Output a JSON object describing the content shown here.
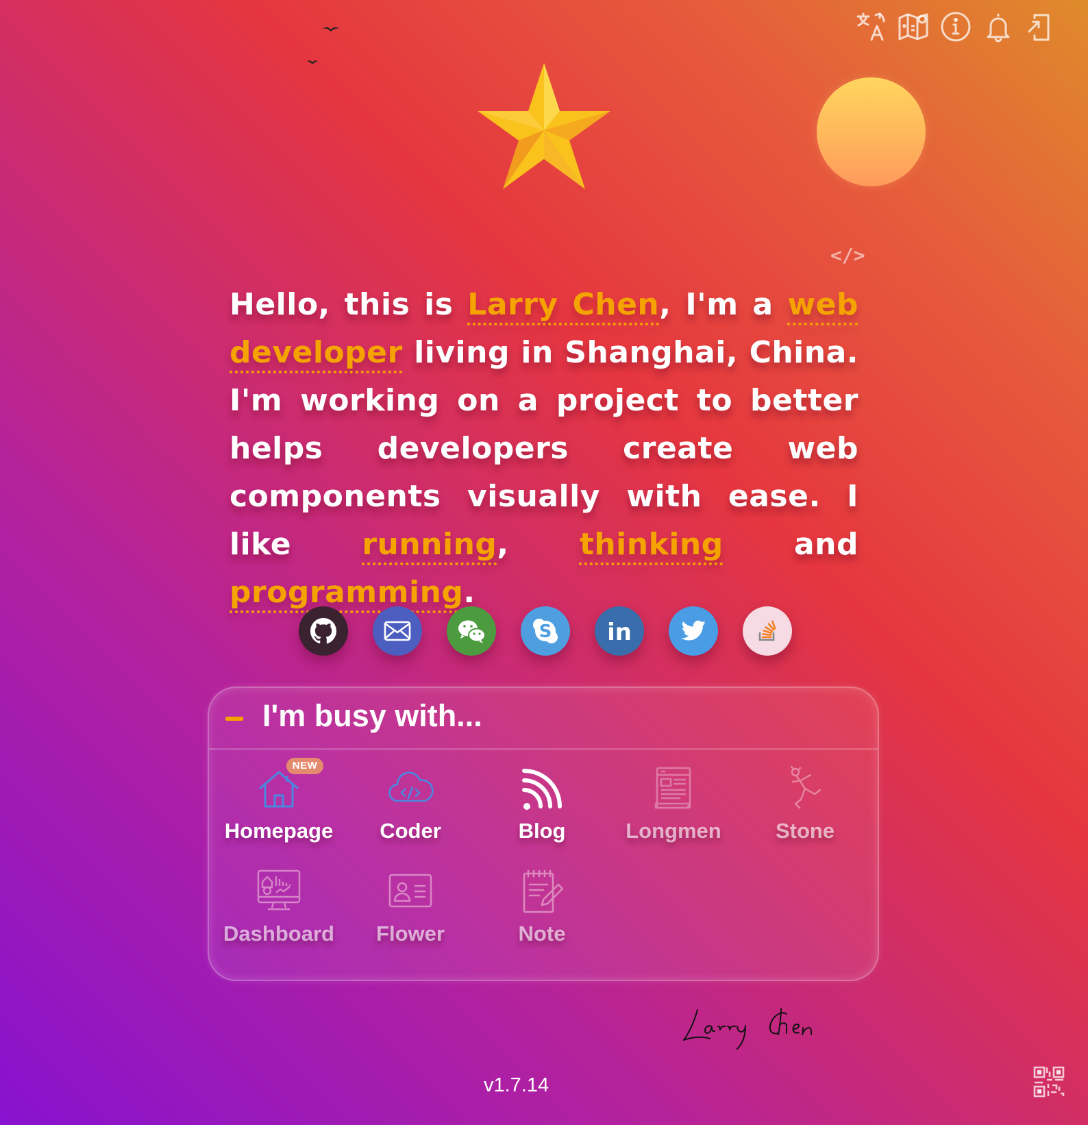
{
  "toolbar": {
    "icons": [
      "translate-icon",
      "map-icon",
      "info-icon",
      "bell-icon",
      "login-icon"
    ]
  },
  "code_icon": "</>",
  "intro": {
    "p1": "Hello, this is",
    "name": "Larry Chen",
    "p2": ", I'm a",
    "role": "web developer",
    "p3": "living in Shanghai, China. I'm working on a project to better helps developers create web components visually with ease. I like",
    "hobby1": "running",
    "sep1": ",",
    "hobby2": "thinking",
    "sep2": "and",
    "hobby3": "programming",
    "end": "."
  },
  "socials": [
    {
      "name": "github",
      "icon": "github-icon",
      "color": "#3a2230"
    },
    {
      "name": "email",
      "icon": "mail-icon",
      "color": "#4c5fc0"
    },
    {
      "name": "wechat",
      "icon": "wechat-icon",
      "color": "#4c9b3f"
    },
    {
      "name": "skype",
      "icon": "skype-icon",
      "color": "#4f9fe0"
    },
    {
      "name": "linkedin",
      "icon": "linkedin-icon",
      "color": "#3a6dab"
    },
    {
      "name": "twitter",
      "icon": "twitter-icon",
      "color": "#4a9de4"
    },
    {
      "name": "stackoverflow",
      "icon": "stackoverflow-icon",
      "color": "#f6dbe4"
    }
  ],
  "busy": {
    "title": "I'm busy with...",
    "badge": "NEW",
    "projects": [
      {
        "label": "Homepage",
        "icon": "house-icon"
      },
      {
        "label": "Coder",
        "icon": "cloud-code-icon"
      },
      {
        "label": "Blog",
        "icon": "rss-icon"
      },
      {
        "label": "Longmen",
        "icon": "document-icon"
      },
      {
        "label": "Stone",
        "icon": "stick-figure-icon"
      },
      {
        "label": "Dashboard",
        "icon": "monitor-chart-icon"
      },
      {
        "label": "Flower",
        "icon": "id-card-icon"
      },
      {
        "label": "Note",
        "icon": "notepad-icon"
      }
    ]
  },
  "signature": "Larry Chen",
  "version": "v1.7.14",
  "colors": {
    "accent": "#f5a300",
    "sun": "#ffb65c"
  }
}
